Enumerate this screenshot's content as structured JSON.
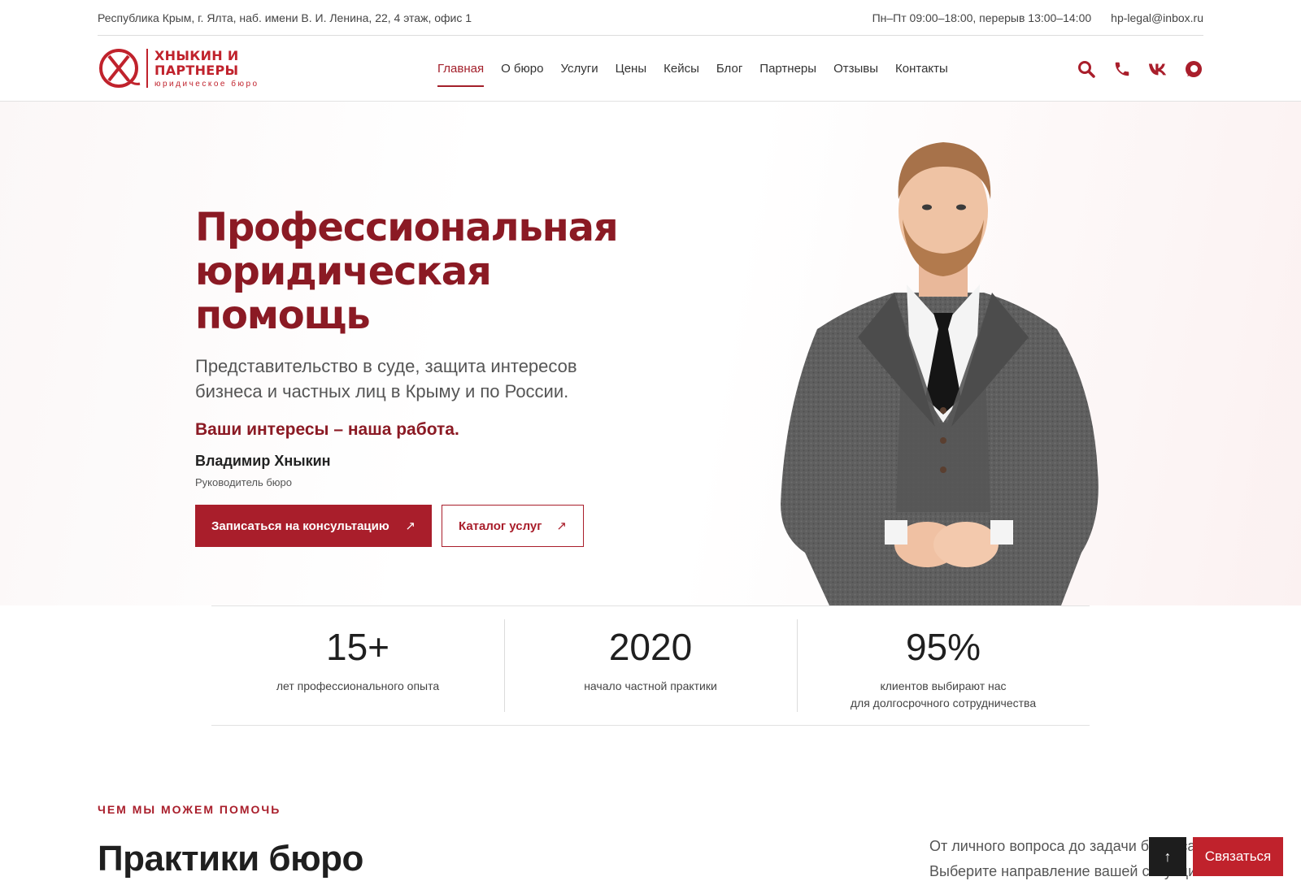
{
  "topbar": {
    "address": "Республика Крым, г. Ялта, наб. имени В. И. Ленина, 22, 4 этаж, офис 1",
    "hours": "Пн–Пт 09:00–18:00, перерыв 13:00–14:00",
    "email": "hp-legal@inbox.ru"
  },
  "logo": {
    "name_line1": "ХНЫКИН И",
    "name_line2": "ПАРТНЕРЫ",
    "subtitle": "юридическое бюро"
  },
  "nav": {
    "items": [
      {
        "label": "Главная",
        "active": true
      },
      {
        "label": "О бюро"
      },
      {
        "label": "Услуги"
      },
      {
        "label": "Цены"
      },
      {
        "label": "Кейсы"
      },
      {
        "label": "Блог"
      },
      {
        "label": "Партнеры"
      },
      {
        "label": "Отзывы"
      },
      {
        "label": "Контакты"
      }
    ]
  },
  "header_icons": [
    "search-icon",
    "phone-icon",
    "vk-icon",
    "max-messenger-icon"
  ],
  "hero": {
    "title_line1": "Профессиональная",
    "title_line2": "юридическая помощь",
    "lead": "Представительство в суде, защита интересов бизнеса и частных лиц в Крыму и по России.",
    "motto": "Ваши интересы – наша работа.",
    "person_name": "Владимир Хныкин",
    "person_role": "Руководитель бюро",
    "primary_button": "Записаться на консультацию",
    "secondary_button": "Каталог услуг",
    "button_arrow": "↗"
  },
  "stats": [
    {
      "value": "15+",
      "label": "лет профессионального опыта"
    },
    {
      "value": "2020",
      "label": "начало частной практики"
    },
    {
      "value": "95%",
      "label": "клиентов выбирают нас\nдля долгосрочного сотрудничества"
    }
  ],
  "practices": {
    "eyebrow": "ЧЕМ МЫ МОЖЕМ ПОМОЧЬ",
    "title": "Практики бюро",
    "desc_line1": "От личного вопроса до задачи бизнеса.",
    "desc_line2": "Выберите направление вашей ситуации."
  },
  "floating": {
    "scroll_top": "↑",
    "contact": "Связаться"
  },
  "colors": {
    "brand": "#a91e2b",
    "brand_dark": "#8b1a24",
    "logo_red": "#c0222c"
  }
}
